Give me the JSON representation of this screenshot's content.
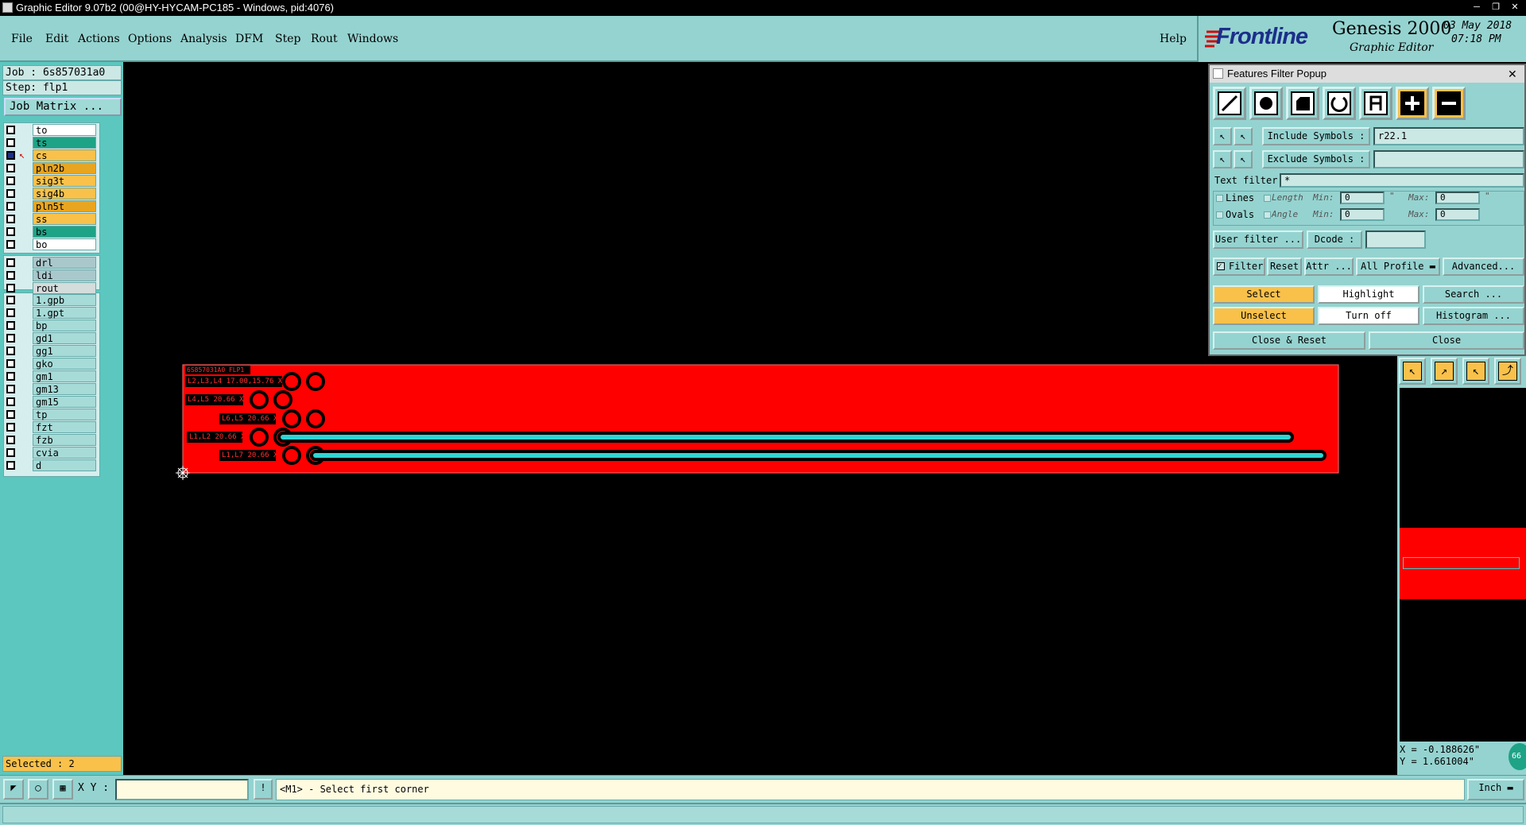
{
  "window": {
    "title": "Graphic Editor 9.07b2 (00@HY-HYCAM-PC185 - Windows, pid:4076)",
    "controls": [
      "minimize-icon",
      "restore-icon",
      "close-icon"
    ]
  },
  "menu": {
    "items": [
      "File",
      "Edit",
      "Actions",
      "Options",
      "Analysis",
      "DFM",
      "Step",
      "Rout",
      "Windows"
    ],
    "help": "Help"
  },
  "brand": {
    "logo": "Frontline",
    "product": "Genesis 2000",
    "subtitle": "Graphic Editor",
    "date": "03 May 2018",
    "time": "07:18 PM"
  },
  "job": {
    "job_label": "Job : 6s857031a0",
    "step_label": "Step: flp1",
    "matrix_button": "Job Matrix ...",
    "selected": "Selected : 2"
  },
  "layers": {
    "group1": [
      {
        "name": "to",
        "color": "#ffffff"
      },
      {
        "name": "ts",
        "color": "#1ea386"
      },
      {
        "name": "cs",
        "color": "#f9c14a"
      },
      {
        "name": "pln2b",
        "color": "#e8a520"
      },
      {
        "name": "sig3t",
        "color": "#f9c14a"
      },
      {
        "name": "sig4b",
        "color": "#f9c14a"
      },
      {
        "name": "pln5t",
        "color": "#e8a520"
      },
      {
        "name": "ss",
        "color": "#f9c14a"
      },
      {
        "name": "bs",
        "color": "#1ea386"
      },
      {
        "name": "bo",
        "color": "#ffffff"
      }
    ],
    "group2": [
      {
        "name": "drl",
        "color": "#a9c8cc"
      },
      {
        "name": "ldi",
        "color": "#a9c8cc"
      },
      {
        "name": "rout",
        "color": "#d4dcdc"
      }
    ],
    "group3": [
      {
        "name": "1.gpb"
      },
      {
        "name": "1.gpt"
      },
      {
        "name": "bp"
      },
      {
        "name": "gd1"
      },
      {
        "name": "gg1"
      },
      {
        "name": "gko"
      },
      {
        "name": "gm1"
      },
      {
        "name": "gm13"
      },
      {
        "name": "gm15"
      },
      {
        "name": "tp"
      },
      {
        "name": "fzt"
      },
      {
        "name": "fzb"
      },
      {
        "name": "cvia"
      },
      {
        "name": "d"
      }
    ]
  },
  "board": {
    "header_text": "6S857031A0 FLP1",
    "labels": [
      "L2,L3,L4 17.00,15.76 X",
      "L4,L5 20.66 X",
      "L6,L5 20.66 X",
      "L1,L2 20.66 X",
      "L1,L7 20.66 X"
    ]
  },
  "popup": {
    "title": "Features Filter Popup",
    "feature_icons": [
      "line-icon",
      "pad-icon",
      "surface-icon",
      "arc-icon",
      "text-icon",
      "positive-icon",
      "negative-icon"
    ],
    "include_label": "Include Symbols :",
    "include_value": "r22.1",
    "exclude_label": "Exclude Symbols :",
    "exclude_value": "",
    "text_filter_label": "Text filter",
    "text_filter_value": "*",
    "lines_label": "Lines",
    "ovals_label": "Ovals",
    "length_label": "Length",
    "angle_label": "Angle",
    "min_label": "Min:",
    "max_label": "Max:",
    "min_value": "0",
    "max_value": "0",
    "length_unit": "\"",
    "user_filter": "User filter ...",
    "dcode_label": "Dcode :",
    "dcode_value": "",
    "filter_label": "Filter",
    "reset": "Reset",
    "attr": "Attr ...",
    "all_profile": "All Profile",
    "advanced": "Advanced...",
    "select": "Select",
    "highlight": "Highlight",
    "search": "Search ...",
    "unselect": "Unselect",
    "turn_off": "Turn off",
    "histogram": "Histogram ...",
    "close_reset": "Close & Reset",
    "close": "Close"
  },
  "coords": {
    "x": "X = -0.188626\"",
    "y": "Y = 1.661004\"",
    "badge": "66"
  },
  "bottom": {
    "xy_label": "X Y :",
    "xy_value": "",
    "prompt": "<M1> - Select first corner",
    "units": "Inch"
  }
}
